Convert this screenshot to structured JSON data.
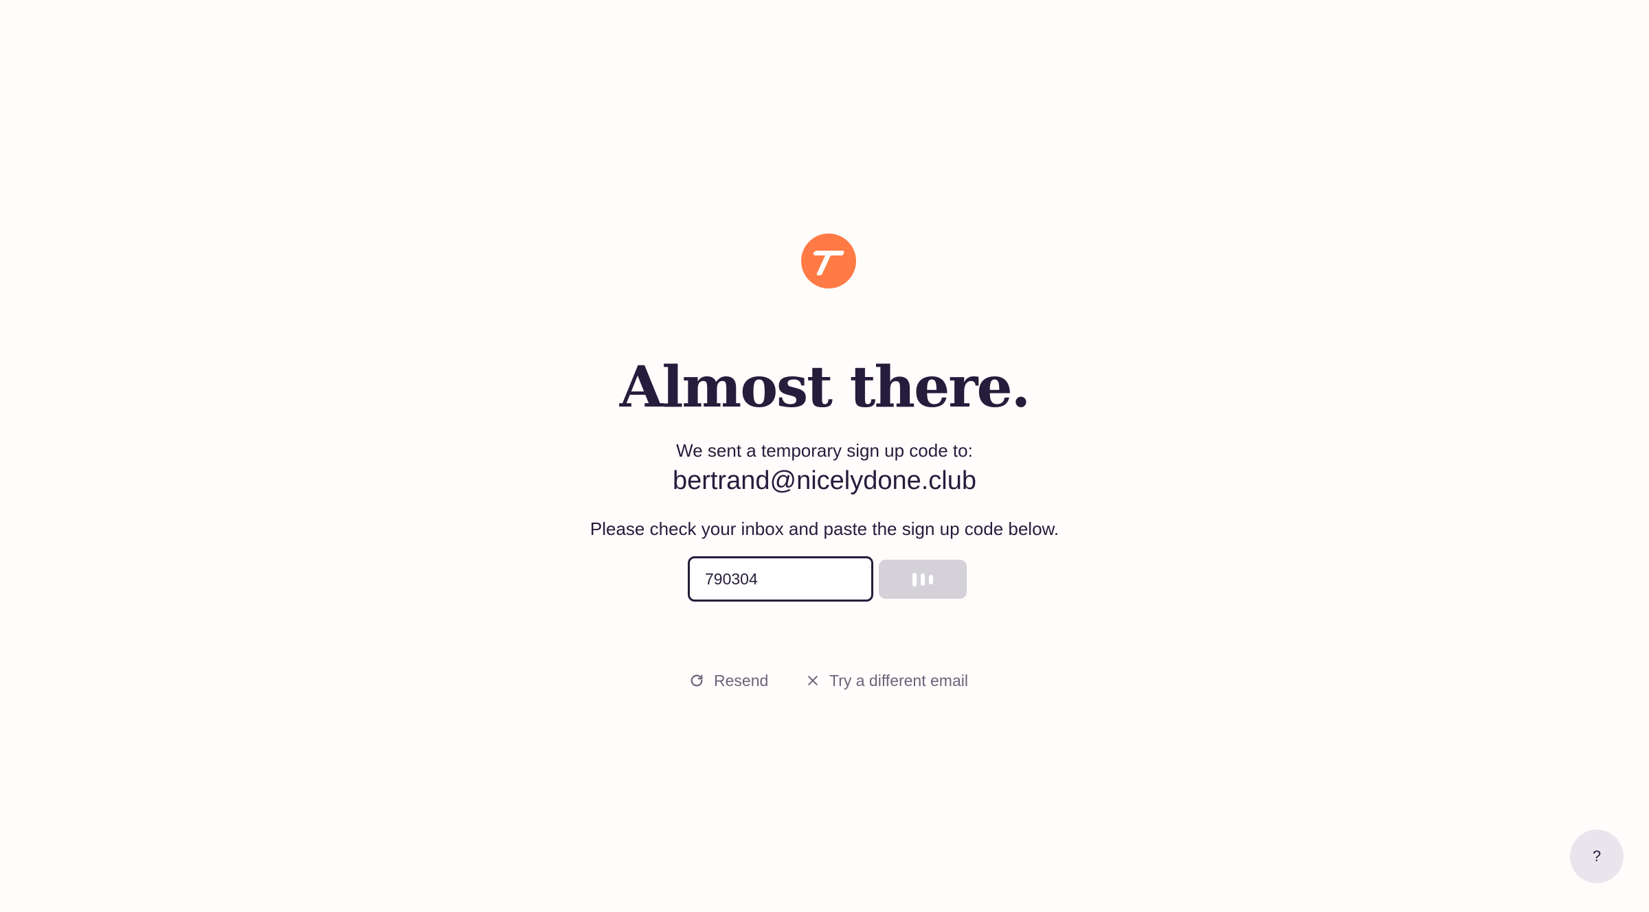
{
  "colors": {
    "accent": "#ff7a45",
    "text": "#261c3b",
    "muted": "#6b6478",
    "button_disabled": "#d4d2d8",
    "background": "#fffcfc"
  },
  "logo": {
    "icon": "logo-t-icon"
  },
  "headline": "Almost there.",
  "sent_text": "We sent a temporary sign up code to:",
  "email": "bertrand@nicelydone.club",
  "instructions": "Please check your inbox and paste the sign up code below.",
  "code_form": {
    "input_value": "790304",
    "submit_state": "loading"
  },
  "actions": {
    "resend_label": "Resend",
    "resend_icon": "refresh-icon",
    "different_email_label": "Try a different email",
    "different_email_icon": "close-icon"
  },
  "help": {
    "label": "?"
  }
}
